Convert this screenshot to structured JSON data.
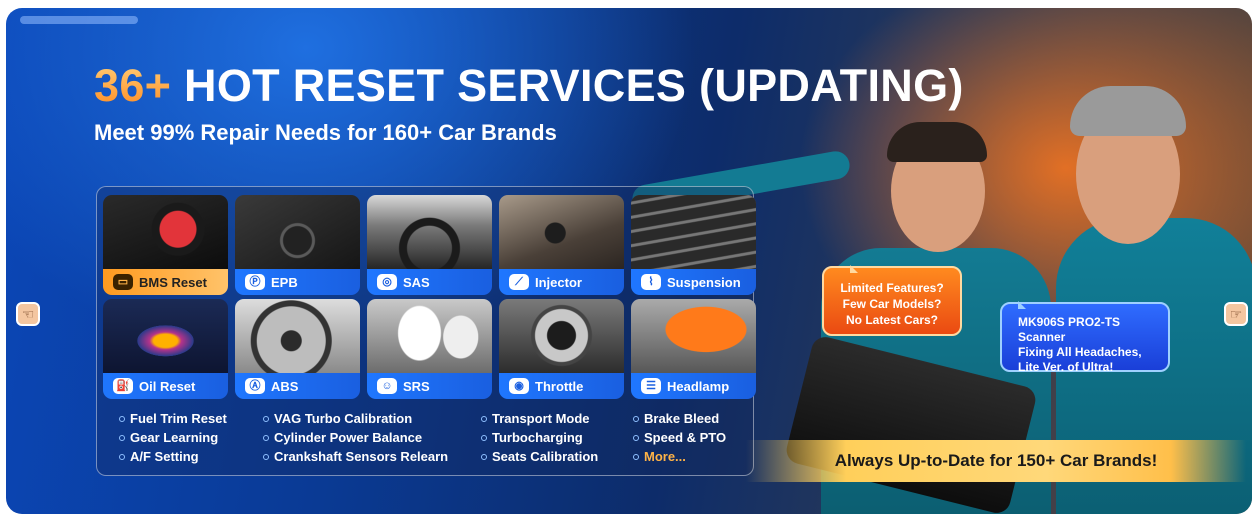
{
  "banner": {
    "title_accent": "36+",
    "title_rest": "HOT RESET SERVICES (UPDATING)",
    "subtitle": "Meet 99% Repair Needs for 160+ Car Brands"
  },
  "services": [
    {
      "label": "BMS Reset",
      "icon": "battery-icon"
    },
    {
      "label": "EPB",
      "icon": "parking-brake-icon"
    },
    {
      "label": "SAS",
      "icon": "steering-wheel-icon"
    },
    {
      "label": "Injector",
      "icon": "injector-icon"
    },
    {
      "label": "Suspension",
      "icon": "suspension-icon"
    },
    {
      "label": "Oil Reset",
      "icon": "oil-can-icon"
    },
    {
      "label": "ABS",
      "icon": "abs-icon"
    },
    {
      "label": "SRS",
      "icon": "airbag-icon"
    },
    {
      "label": "Throttle",
      "icon": "throttle-icon"
    },
    {
      "label": "Headlamp",
      "icon": "headlamp-icon"
    }
  ],
  "extra_services": {
    "col1": [
      "Fuel Trim Reset",
      "Gear Learning",
      "A/F Setting"
    ],
    "col2": [
      "VAG Turbo Calibration",
      "Cylinder Power Balance",
      "Crankshaft Sensors Relearn"
    ],
    "col3": [
      "Transport Mode",
      "Turbocharging",
      "Seats Calibration"
    ],
    "col4": [
      "Brake Bleed",
      "Speed & PTO",
      "More..."
    ]
  },
  "bubble_left": [
    "Limited Features?",
    "Few Car Models?",
    "No Latest Cars?"
  ],
  "bubble_right": [
    "MK906S PRO2-TS Scanner",
    "Fixing All Headaches,",
    "Lite Ver. of Ultra!"
  ],
  "ribbon": "Always Up-to-Date for 150+ Car Brands!",
  "colors": {
    "accent_orange": "#ffb347",
    "service_blue": "#1f77ff",
    "ribbon_gold": "#ffcf5a"
  }
}
